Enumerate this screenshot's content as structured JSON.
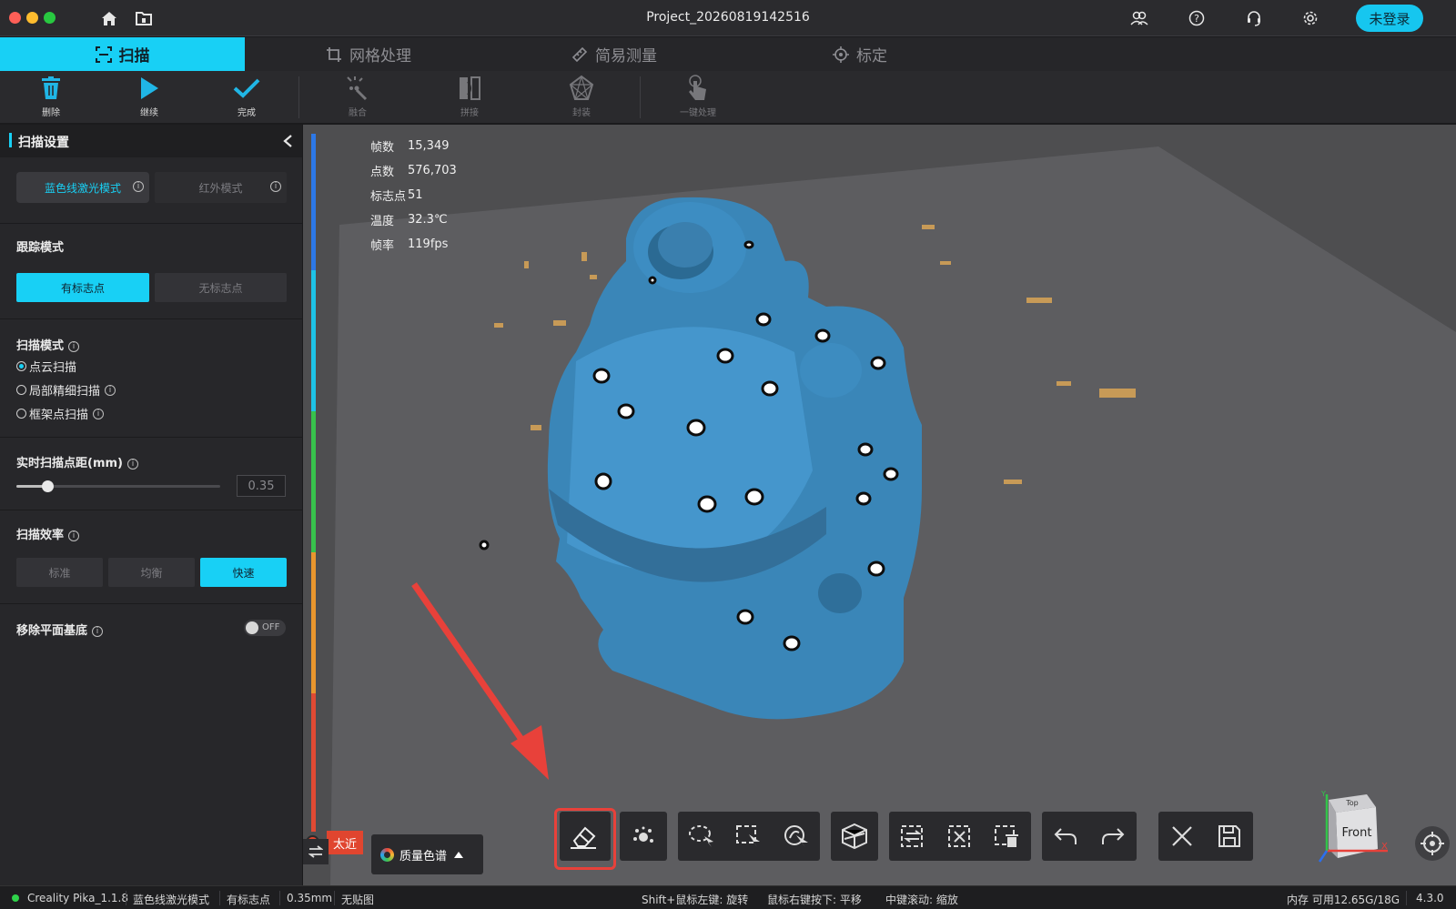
{
  "window": {
    "title": "Project_20260819142516",
    "login_label": "未登录"
  },
  "tabs": [
    {
      "label": "扫描",
      "icon": "scan-frame-icon",
      "active": true
    },
    {
      "label": "网格处理",
      "icon": "crop-icon",
      "active": false
    },
    {
      "label": "简易测量",
      "icon": "ruler-icon",
      "active": false
    },
    {
      "label": "标定",
      "icon": "crosshair-icon",
      "active": false
    }
  ],
  "toolbar": {
    "delete": "删除",
    "continue": "继续",
    "finish": "完成",
    "fuse": "融合",
    "stitch": "拼接",
    "encapsulate": "封装",
    "one_click": "一键处理"
  },
  "panel": {
    "title": "扫描设置",
    "laser_modes": [
      "蓝色线激光模式",
      "红外模式"
    ],
    "laser_mode_selected": "蓝色线激光模式",
    "tracking_title": "跟踪模式",
    "tracking_options": [
      "有标志点",
      "无标志点"
    ],
    "tracking_selected": "有标志点",
    "scan_mode_title": "扫描模式",
    "scan_modes": [
      "点云扫描",
      "局部精细扫描",
      "框架点扫描"
    ],
    "scan_mode_selected": "点云扫描",
    "point_distance_title": "实时扫描点距(mm)",
    "point_distance_value": "0.35",
    "point_distance_fraction": 0.15,
    "efficiency_title": "扫描效率",
    "efficiency_options": [
      "标准",
      "均衡",
      "快速"
    ],
    "efficiency_selected": "快速",
    "remove_base_title": "移除平面基底",
    "remove_base_state": "OFF"
  },
  "stats": [
    {
      "label": "帧数",
      "value": "15,349"
    },
    {
      "label": "点数",
      "value": "576,703"
    },
    {
      "label": "标志点",
      "value": "51"
    },
    {
      "label": "温度",
      "value": "32.3℃"
    },
    {
      "label": "帧率",
      "value": "119fps"
    }
  ],
  "distance_badge": "太近",
  "quality_button": "质量色谱",
  "orientation_cube": {
    "face_front": "Front",
    "face_top": "Top",
    "axis_x": "X",
    "axis_y": "Y"
  },
  "colors": {
    "accent": "#18d0f5",
    "warning": "#e0452f",
    "model": "#3a86b8"
  },
  "statusbar": {
    "device": "Creality Pika_1.1.8",
    "laser_mode": "蓝色线激光模式",
    "tracking": "有标志点",
    "point_distance": "0.35mm",
    "texture": "无贴图",
    "hint_rotate": "Shift+鼠标左键: 旋转",
    "hint_pan": "鼠标右键按下: 平移",
    "hint_zoom": "中键滚动: 缩放",
    "memory": "内存 可用12.65G/18G",
    "version": "4.3.0"
  }
}
